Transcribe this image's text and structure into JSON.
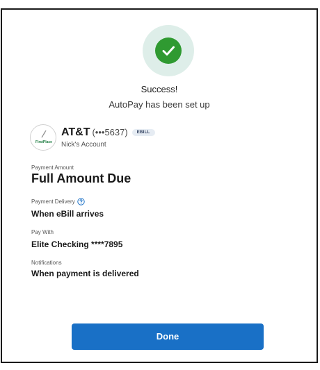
{
  "success": {
    "title": "Success!",
    "subtitle": "AutoPay has been set up"
  },
  "biller": {
    "logo_text": "FirstPlace",
    "name": "AT&T",
    "account_mask": "(•••5637)",
    "badge": "EBILL",
    "nickname": "Nick's Account"
  },
  "fields": {
    "payment_amount": {
      "label": "Payment Amount",
      "value": "Full Amount Due"
    },
    "payment_delivery": {
      "label": "Payment Delivery",
      "value": "When eBill arrives"
    },
    "pay_with": {
      "label": "Pay With",
      "value": "Elite Checking ****7895"
    },
    "notifications": {
      "label": "Notifications",
      "value": "When payment is delivered"
    }
  },
  "actions": {
    "done_label": "Done"
  },
  "icons": {
    "success": "checkmark-circle-icon",
    "help": "question-circle-icon"
  },
  "colors": {
    "success_green": "#2f9a31",
    "success_halo": "#deeee9",
    "primary_blue": "#1970c6",
    "help_blue": "#1970c6"
  }
}
